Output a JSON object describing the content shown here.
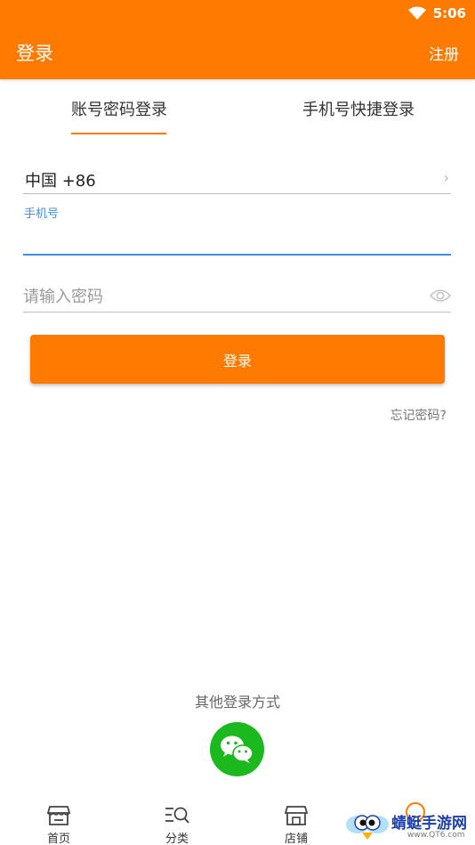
{
  "status_bar": {
    "time": "5:06"
  },
  "header": {
    "title": "登录",
    "register_label": "注册"
  },
  "tabs": [
    {
      "label": "账号密码登录",
      "active": true
    },
    {
      "label": "手机号快捷登录",
      "active": false
    }
  ],
  "form": {
    "country_value": "中国 +86",
    "phone_label": "手机号",
    "phone_value": "",
    "password_placeholder": "请输入密码",
    "login_label": "登录",
    "forgot_label": "忘记密码?"
  },
  "other_login": {
    "label": "其他登录方式",
    "icon": "wechat-icon"
  },
  "bottom_nav": [
    {
      "label": "首页",
      "icon": "home-store-icon"
    },
    {
      "label": "分类",
      "icon": "category-search-icon"
    },
    {
      "label": "店铺",
      "icon": "shop-icon"
    }
  ],
  "watermark": {
    "text": "蜻蜓手游网",
    "url": "www.QT6.com"
  },
  "colors": {
    "brand": "#ff7a00",
    "focus": "#3d8fe0",
    "wechat": "#1bb91e"
  }
}
